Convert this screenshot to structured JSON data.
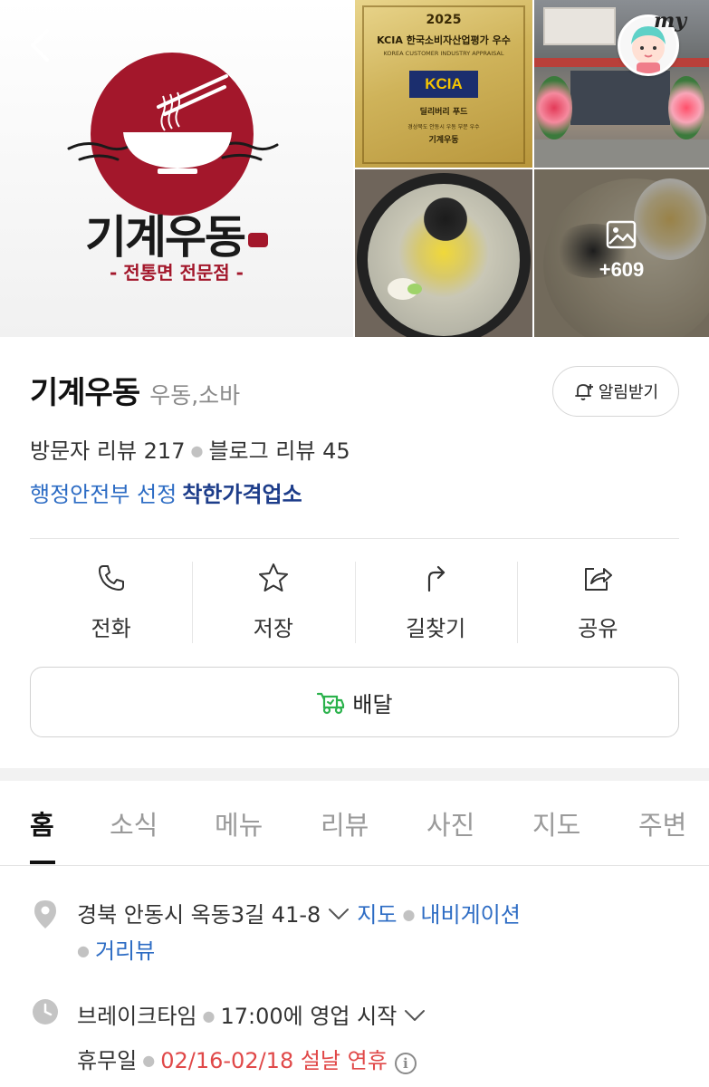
{
  "header": {
    "logo": {
      "name": "기계우동",
      "subtitle": "- 전통면 전문점 -"
    },
    "certificate": {
      "year": "2025",
      "title": "KCIA 한국소비자산업평가 우수",
      "subtitle": "KOREA CUSTOMER INDUSTRY APPRAISAL",
      "logo_text": "KCIA",
      "org": "딜리버리 푸드",
      "category": "경상북도 안동시 우동 부문 우수",
      "name": "기계우동"
    },
    "more_photos": "+609",
    "profile_badge": "my"
  },
  "place": {
    "name": "기계우동",
    "category": "우동,소바",
    "alert_label": "알림받기",
    "visitor_reviews": "방문자 리뷰 217",
    "blog_reviews": "블로그 리뷰 45",
    "badge_prefix": "행정안전부 선정",
    "badge_title": "착한가격업소"
  },
  "actions": [
    {
      "label": "전화",
      "icon": "phone-icon"
    },
    {
      "label": "저장",
      "icon": "star-icon"
    },
    {
      "label": "길찾기",
      "icon": "directions-icon"
    },
    {
      "label": "공유",
      "icon": "share-icon"
    }
  ],
  "delivery": {
    "label": "배달",
    "icon": "delivery-icon"
  },
  "tabs": [
    "홈",
    "소식",
    "메뉴",
    "리뷰",
    "사진",
    "지도",
    "주변"
  ],
  "active_tab": "홈",
  "details": {
    "address": "경북 안동시 옥동3길 41-8",
    "map_link": "지도",
    "navigation_link": "내비게이션",
    "streetview_link": "거리뷰",
    "hours_status": "브레이크타임",
    "hours_detail": "17:00에 영업 시작",
    "closed_label": "휴무일",
    "closed_detail": "02/16-02/18 설날 연휴"
  },
  "colors": {
    "brand_red": "#a3172b",
    "link_blue": "#2d6cc4",
    "badge_navy": "#1d3d8a",
    "holiday_red": "#e04848",
    "delivery_green": "#2bb24c"
  }
}
